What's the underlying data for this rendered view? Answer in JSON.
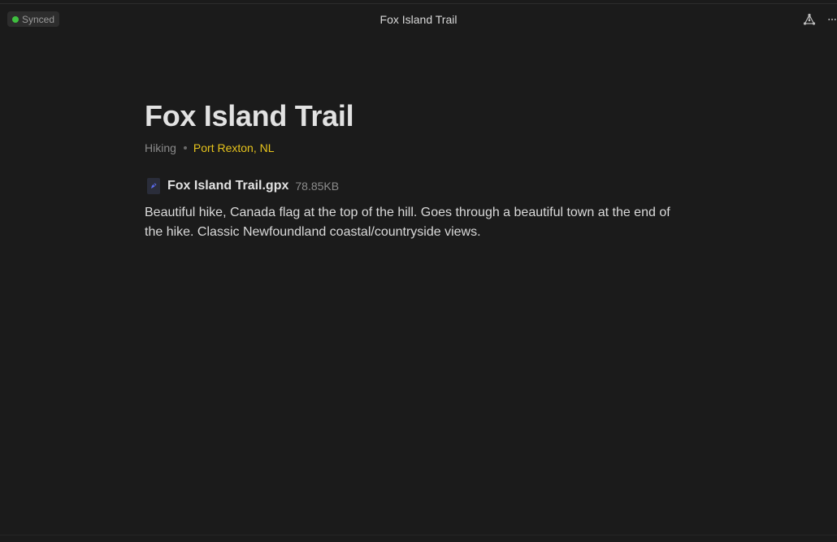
{
  "header": {
    "sync_status": "Synced",
    "title": "Fox Island Trail",
    "icons": [
      "graph-icon",
      "more-icon"
    ]
  },
  "note": {
    "title": "Fox Island Trail",
    "tag": "Hiking",
    "location": "Port Rexton, NL",
    "attachment": {
      "name": "Fox Island Trail.gpx",
      "size": "78.85KB",
      "icon": "gpx-file-icon"
    },
    "body": "Beautiful hike, Canada flag at the top of the hill. Goes through a beautiful town at the end of the hike. Classic Newfoundland coastal/countryside views."
  },
  "colors": {
    "background": "#1b1b1b",
    "synced_dot": "#3fbf3f",
    "location_accent": "#e6c31c",
    "file_icon_accent": "#5b6cf0"
  }
}
